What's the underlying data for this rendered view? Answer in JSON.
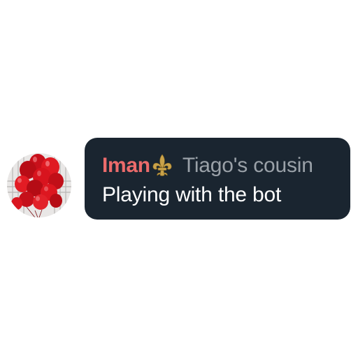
{
  "message": {
    "sender_name": "Iman",
    "sender_badge_icon": "fleur-de-lis-icon",
    "sender_tag": "Tiago's cousin",
    "text": "Playing with the bot"
  },
  "avatar": {
    "icon": "red-balloons-photo"
  },
  "colors": {
    "bubble_background": "#1a2530",
    "sender_name": "#ec6b6b",
    "sender_tag": "#9aa1a8",
    "message_text": "#ffffff",
    "badge_gold": "#c9a24a"
  }
}
